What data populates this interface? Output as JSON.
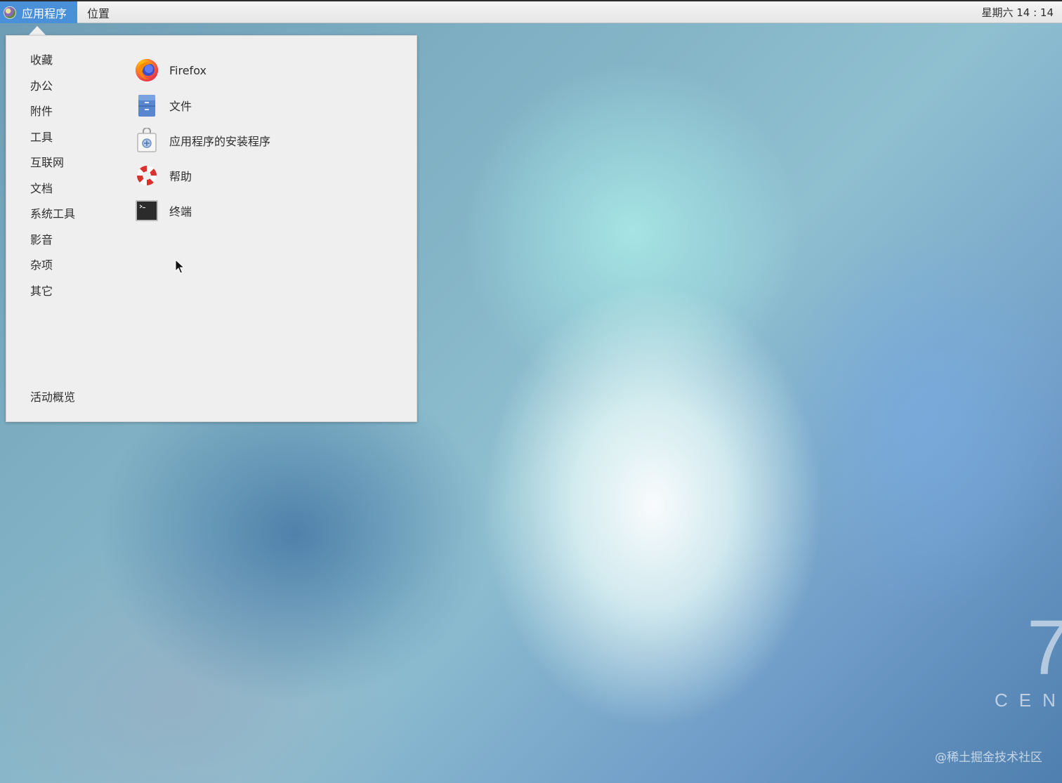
{
  "topbar": {
    "applications_label": "应用程序",
    "places_label": "位置",
    "clock": "星期六 14 : 14"
  },
  "menu": {
    "categories": [
      "收藏",
      "办公",
      "附件",
      "工具",
      "互联网",
      "文档",
      "系统工具",
      "影音",
      "杂项",
      "其它"
    ],
    "apps": [
      {
        "label": "Firefox",
        "icon": "firefox-icon"
      },
      {
        "label": "文件",
        "icon": "files-icon"
      },
      {
        "label": "应用程序的安装程序",
        "icon": "software-installer-icon"
      },
      {
        "label": "帮助",
        "icon": "help-lifebuoy-icon"
      },
      {
        "label": "终端",
        "icon": "terminal-icon"
      }
    ],
    "activities_overview": "活动概览"
  },
  "desktop": {
    "centos_seven": "7",
    "centos_text": "CENT",
    "watermark": "@稀土掘金技术社区"
  },
  "colors": {
    "accent": "#4a90d9",
    "menu_bg": "#efefef",
    "topbar_bg": "#ececec"
  }
}
